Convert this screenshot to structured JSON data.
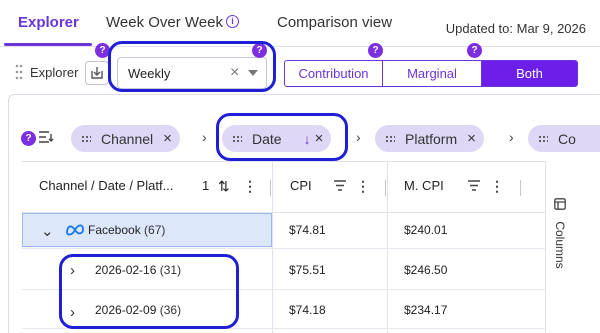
{
  "tabs": [
    {
      "label": "Explorer",
      "active": true
    },
    {
      "label": "Week Over Week",
      "active": false,
      "has_info": true
    },
    {
      "label": "Comparison view",
      "active": false
    }
  ],
  "info_glyph": "i",
  "updated_text": "Updated to: Mar 9, 2026",
  "help_glyph": "?",
  "controls": {
    "label": "Explorer",
    "download_icon": "download-icon",
    "granularity": {
      "value": "Weekly",
      "clear": "×"
    },
    "modes": [
      {
        "label": "Contribution",
        "selected": false
      },
      {
        "label": "Marginal",
        "selected": false
      },
      {
        "label": "Both",
        "selected": true
      }
    ]
  },
  "group_by": {
    "chips": [
      {
        "label": "Channel",
        "remove": "×"
      },
      {
        "label": "Date",
        "remove": "×",
        "sort": "↓"
      },
      {
        "label": "Platform",
        "remove": "×"
      },
      {
        "label": "Co",
        "remove": ""
      }
    ],
    "separator": "›"
  },
  "grid": {
    "columns": [
      {
        "label": "Channel / Date / Platf...",
        "sort_index": "1",
        "sort_icon": "⇅"
      },
      {
        "label": "CPI"
      },
      {
        "label": "M. CPI"
      }
    ],
    "menu_glyph": "⋮",
    "rows": [
      {
        "level": 0,
        "expanded": true,
        "icon": "meta-icon",
        "label": "Facebook",
        "count": "(67)",
        "cpi": "$74.81",
        "mcpi": "$240.01"
      },
      {
        "level": 1,
        "expanded": false,
        "label": "2026-02-16",
        "count": "(31)",
        "cpi": "$75.51",
        "mcpi": "$246.50"
      },
      {
        "level": 1,
        "expanded": false,
        "label": "2026-02-09",
        "count": "(36)",
        "cpi": "$74.18",
        "mcpi": "$234.17"
      }
    ],
    "chevron_down": "⌄",
    "chevron_right": "›"
  },
  "side_panel": {
    "label": "Columns"
  },
  "colors": {
    "accent": "#6b35d9",
    "selected_segment": "#6b1fe8",
    "chip_bg": "#ded8f6",
    "selected_row": "#dce8fa",
    "annotation_ring": "#1f1fd6"
  }
}
